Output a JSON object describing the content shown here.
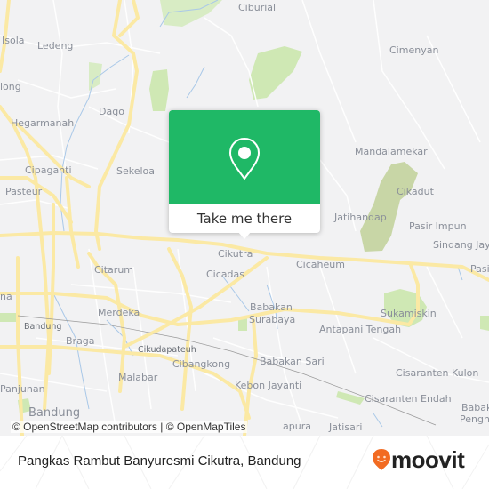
{
  "map": {
    "colors": {
      "background": "#f2f2f3",
      "road_major": "#fbe9a4",
      "road_minor": "#ffffff",
      "water": "#a9c8e8",
      "park": "#cfe8b4",
      "park_dark": "#c8d6a6",
      "rail": "#9a9a9a"
    },
    "places": [
      {
        "name": "Isola",
        "size": "normal"
      },
      {
        "name": "Ledeng",
        "size": "normal"
      },
      {
        "name": "Ciburial",
        "size": "normal"
      },
      {
        "name": "Cimenyan",
        "size": "normal"
      },
      {
        "name": "long",
        "size": "normal"
      },
      {
        "name": "Dago",
        "size": "normal"
      },
      {
        "name": "Hegarmanah",
        "size": "normal"
      },
      {
        "name": "Mandalamekar",
        "size": "normal"
      },
      {
        "name": "Cipaganti",
        "size": "normal"
      },
      {
        "name": "Sekeloa",
        "size": "normal"
      },
      {
        "name": "Cikadut",
        "size": "normal"
      },
      {
        "name": "Pasteur",
        "size": "normal"
      },
      {
        "name": "Jatihandap",
        "size": "normal"
      },
      {
        "name": "Pasir Impun",
        "size": "normal"
      },
      {
        "name": "Sindang Jaya",
        "size": "normal"
      },
      {
        "name": "Cikutra",
        "size": "normal"
      },
      {
        "name": "Citarum",
        "size": "normal"
      },
      {
        "name": "Cicaheum",
        "size": "normal"
      },
      {
        "name": "Pasi",
        "size": "normal"
      },
      {
        "name": "Cicadas",
        "size": "normal"
      },
      {
        "name": "na",
        "size": "normal"
      },
      {
        "name": "Merdeka",
        "size": "normal"
      },
      {
        "name": "Babakan",
        "size": "normal"
      },
      {
        "name": "Surabaya",
        "size": "normal"
      },
      {
        "name": "Sukamiskin",
        "size": "normal"
      },
      {
        "name": "Bandung",
        "size": "small"
      },
      {
        "name": "Antapani Tengah",
        "size": "normal"
      },
      {
        "name": "Braga",
        "size": "normal"
      },
      {
        "name": "Cikudapateuh",
        "size": "small"
      },
      {
        "name": "Cibangkong",
        "size": "normal"
      },
      {
        "name": "Babakan Sari",
        "size": "normal"
      },
      {
        "name": "Malabar",
        "size": "normal"
      },
      {
        "name": "Cisaranten Kulon",
        "size": "normal"
      },
      {
        "name": "Panjunan",
        "size": "normal"
      },
      {
        "name": "Kebon Jayanti",
        "size": "normal"
      },
      {
        "name": "Cisaranten Endah",
        "size": "normal"
      },
      {
        "name": "Bandung",
        "size": "big"
      },
      {
        "name": "Babak",
        "size": "normal"
      },
      {
        "name": "Pengh",
        "size": "normal"
      },
      {
        "name": "apura",
        "size": "normal"
      },
      {
        "name": "Jatisari",
        "size": "normal"
      }
    ],
    "attribution": "© OpenStreetMap contributors | © OpenMapTiles"
  },
  "popup": {
    "icon": "map-pin-icon",
    "button_label": "Take me there",
    "color": "#1fb866"
  },
  "footer": {
    "title": "Pangkas Rambut Banyuresmi Cikutra, Bandung",
    "brand": {
      "name": "moovit",
      "icon": "moovit-smiley-pin-icon",
      "color": "#f26b22"
    }
  }
}
